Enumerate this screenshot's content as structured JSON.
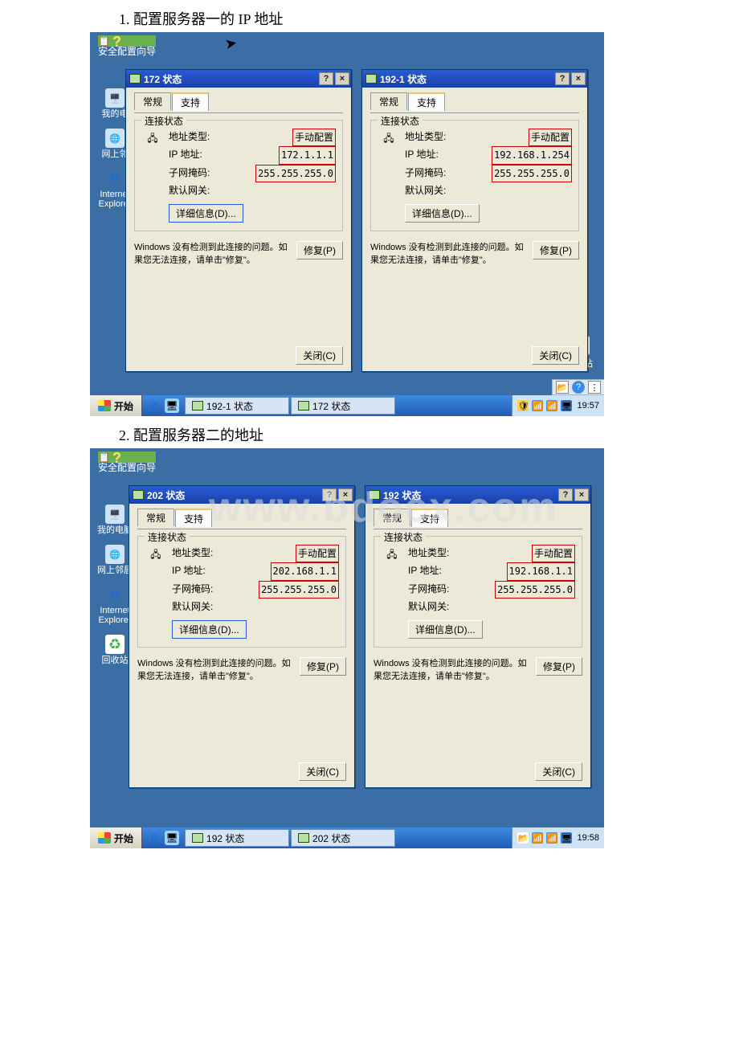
{
  "watermark": "www.bdocx.com",
  "headings": {
    "h1": "1. 配置服务器一的 IP 地址",
    "h2": "2. 配置服务器二的地址"
  },
  "common": {
    "tab_general": "常规",
    "tab_support": "支持",
    "group_legend": "连接状态",
    "lbl_addrtype": "地址类型:",
    "lbl_ip": "IP 地址:",
    "lbl_mask": "子网掩码:",
    "lbl_gateway": "默认网关:",
    "btn_details": "详细信息(D)...",
    "repair_text": "Windows 没有检测到此连接的问题。如果您无法连接，请单击\"修复\"。",
    "btn_repair": "修复(P)",
    "btn_close": "关闭(C)",
    "val_manual": "手动配置",
    "mask": "255.255.255.0",
    "scw_label": "安全配置向导",
    "recycle": "回收站",
    "start": "开始"
  },
  "desktop": {
    "mycomputer": "我的电",
    "mycomputer2": "我的电脑",
    "netplaces": "网上邻",
    "netplaces2": "网上邻居",
    "ie_short": "Internet",
    "ie_short2": "Explorer",
    "ie_full": "Internet Explorer"
  },
  "sh1": {
    "left_title": "172 状态",
    "right_title": "192-1 状态",
    "left_ip": "172.1.1.1",
    "right_ip": "192.168.1.254",
    "task1": "192-1 状态",
    "task2": "172 状态",
    "clock": "19:57"
  },
  "sh2": {
    "left_title": "202 状态",
    "right_title": "192 状态",
    "left_ip": "202.168.1.1",
    "right_ip": "192.168.1.1",
    "task1": "192 状态",
    "task2": "202 状态",
    "clock": "19:58"
  }
}
